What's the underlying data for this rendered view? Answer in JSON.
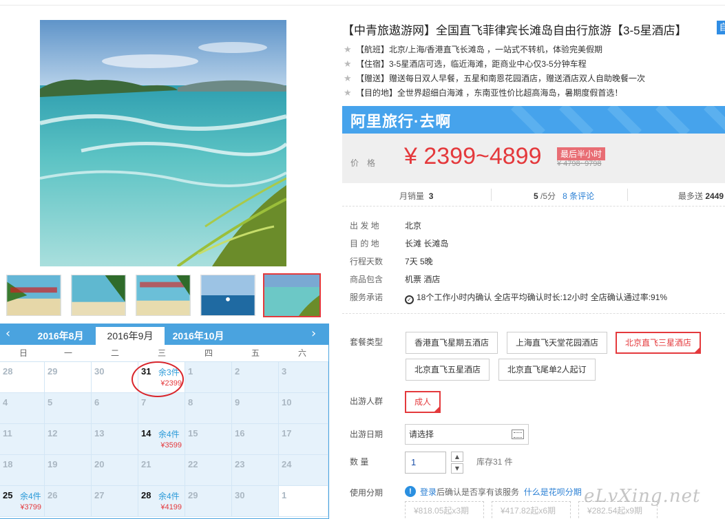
{
  "title": "【中青旅遨游网】全国直飞菲律宾长滩岛自由行旅游【3-5星酒店】",
  "title_tag": "自",
  "features": [
    "【航班】北京/上海/香港直飞长滩岛 ，一站式不转机，体验完美假期",
    "【住宿】3-5星酒店可选，临近海滩，距商业中心仅3-5分钟车程",
    "【赠送】赠送每日双人早餐，五星和南恩花园酒店，赠送酒店双人自助晚餐一次",
    "【目的地】全世界超细白海滩 ，东南亚性价比超高海岛，暑期度假首选！"
  ],
  "banner": {
    "text": "阿里旅行·去啊"
  },
  "price": {
    "label": "价格",
    "value": "¥ 2399~4899",
    "promo": "最后半小时",
    "original": "¥ 4798~9798"
  },
  "stats": {
    "sales_label": "月销量",
    "sales_value": "3",
    "rating_value": "5",
    "rating_suffix": "/5分",
    "reviews": "8 条评论",
    "points_label": "最多送",
    "points_value": "2449"
  },
  "info": {
    "departure_label": "出 发 地",
    "departure": "北京",
    "destination_label": "目 的 地",
    "destination": "长滩   长滩岛",
    "duration_label": "行程天数",
    "duration": "7天 5晚",
    "includes_label": "商品包含",
    "includes": "机票   酒店",
    "service_label": "服务承诺",
    "service": "18个工作小时内确认     全店平均确认时长:12小时     全店确认通过率:91%"
  },
  "package": {
    "label": "套餐类型",
    "options": [
      "香港直飞星期五酒店",
      "上海直飞天堂花园酒店",
      "北京直飞三星酒店",
      "北京直飞五星酒店",
      "北京直飞尾单2人起订"
    ]
  },
  "travelers": {
    "label": "出游人群",
    "option": "成人"
  },
  "date": {
    "label": "出游日期",
    "placeholder": "请选择"
  },
  "quantity": {
    "label": "数    量",
    "value": "1",
    "stock": "库存31 件"
  },
  "installment": {
    "label": "使用分期",
    "login": "登录",
    "text": "后确认是否享有该服务",
    "link": "什么是花呗分期",
    "plans": [
      "¥818.05起x3期",
      "¥417.82起x6期",
      "¥282.54起x9期"
    ]
  },
  "calendar": {
    "prev_arrow": "‹",
    "next_arrow": "›",
    "months": [
      "2016年8月",
      "2016年9月",
      "2016年10月"
    ],
    "weekdays": [
      "日",
      "一",
      "二",
      "三",
      "四",
      "五",
      "六"
    ],
    "days": [
      [
        "28",
        "29",
        "30",
        "31",
        "1",
        "2",
        "3"
      ],
      [
        "4",
        "5",
        "6",
        "7",
        "8",
        "9",
        "10"
      ],
      [
        "11",
        "12",
        "13",
        "14",
        "15",
        "16",
        "17"
      ],
      [
        "18",
        "19",
        "20",
        "21",
        "22",
        "23",
        "24"
      ],
      [
        "25",
        "26",
        "27",
        "28",
        "29",
        "30",
        "1"
      ]
    ],
    "availability": {
      "d31": {
        "stock": "余3件",
        "price": "¥2399"
      },
      "d14": {
        "stock": "余4件",
        "price": "¥3599"
      },
      "d25": {
        "stock": "余4件",
        "price": "¥3799"
      },
      "d28": {
        "stock": "余4件",
        "price": "¥4199"
      }
    }
  },
  "watermark": "eLvXing.net",
  "colors": {
    "accent": "#e4393c",
    "blue": "#46a3ec",
    "link": "#2a7fd4"
  }
}
